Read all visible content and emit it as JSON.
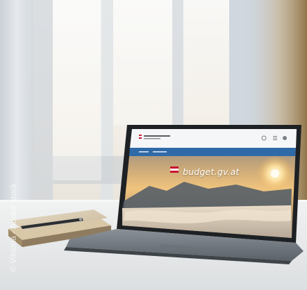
{
  "photo_credit": "© Viktoria - Adobe stock",
  "laptop_screen": {
    "brand_text": "budget.gv.at",
    "flag_colors": {
      "red": "#c8102e",
      "white": "#ffffff"
    },
    "nav_bar_color": "#2f6aa8",
    "icon_names": [
      "search-icon",
      "menu-icon",
      "accessibility-icon"
    ]
  }
}
